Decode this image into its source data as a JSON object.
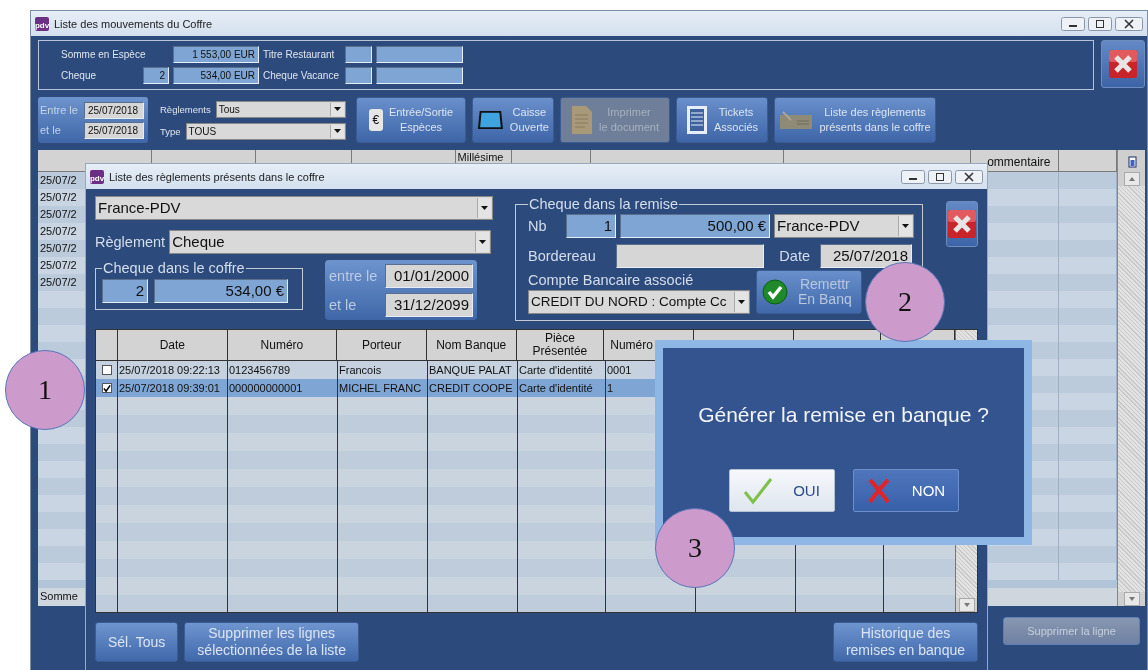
{
  "main_window": {
    "logo": "pdv",
    "title": "Liste des mouvements du Coffre",
    "summary": {
      "cash_label": "Somme en Espèce",
      "cash_total": "1 553,00 EUR",
      "cheque_label": "Cheque",
      "cheque_count": "2",
      "cheque_total": "534,00 EUR",
      "restaurant_label": "Titre Restaurant",
      "vacance_label": "Cheque Vacance"
    },
    "period": {
      "from_label": "Entre le",
      "from": "25/07/2018",
      "to_label": "et le",
      "to": "25/07/2018"
    },
    "filters": [
      {
        "label": "Règlements",
        "value": "Tous"
      },
      {
        "label": "Type",
        "value": "TOUS"
      }
    ],
    "toolbar": [
      {
        "kind": "euro",
        "glyph": "€",
        "label": "Entrée/Sortie\nEspèces",
        "disabled": false
      },
      {
        "kind": "tablet",
        "label": "Caisse\nOuverte",
        "disabled": false
      },
      {
        "kind": "document",
        "label": "Imprimer\nle document",
        "disabled": true
      },
      {
        "kind": "list",
        "label": "Tickets\nAssociés",
        "disabled": false
      },
      {
        "kind": "cheque",
        "label": "Liste des règlements\nprésents dans le coffre",
        "disabled": false
      }
    ],
    "table": {
      "columns": [
        "Millésime",
        "ommentaire"
      ],
      "rows": [
        "25/07/2",
        "25/07/2",
        "25/07/2",
        "25/07/2",
        "25/07/2",
        "25/07/2",
        "25/07/2"
      ],
      "footer_label": "Somme"
    },
    "delete_button": {
      "label": "Supprimer la ligne",
      "disabled": true
    }
  },
  "dialog": {
    "logo": "pdv",
    "title": "Liste des règlements présents dans le coffre",
    "shop": "France-PDV",
    "payment_label": "Règlement",
    "payment": "Cheque",
    "safe_group": {
      "title": "Cheque dans le coffre",
      "count": "2",
      "total": "534,00 €"
    },
    "period": {
      "from_label": "entre le",
      "from": "01/01/2000",
      "to_label": "et le",
      "to": "31/12/2099"
    },
    "deposit_group": {
      "title": "Cheque dans la remise",
      "nb_label": "Nb",
      "count": "1",
      "total": "500,00 €",
      "shop": "France-PDV",
      "slip_label": "Bordereau",
      "date_label": "Date",
      "date": "25/07/2018",
      "account_label": "Compte Bancaire associé",
      "account": "CREDIT DU NORD : Compte Cc"
    },
    "deposit_button": "Remettr\nEn Banq",
    "table": {
      "columns": [
        "Date",
        "Numéro",
        "Porteur",
        "Nom Banque",
        "Pièce\nPrésentée",
        "Numéro"
      ],
      "rows": [
        {
          "checked": false,
          "selected": false,
          "cells": [
            "25/07/2018 09:22:13",
            "0123456789",
            "Francois",
            "BANQUE PALAT",
            "Carte d'identité",
            "0001"
          ]
        },
        {
          "checked": true,
          "selected": true,
          "cells": [
            "25/07/2018 09:39:01",
            "000000000001",
            "MICHEL FRANC",
            "CREDIT COOPE",
            "Carte d'identité",
            "1"
          ]
        }
      ]
    },
    "buttons": [
      "Sél. Tous",
      "Supprimer les lignes\nsélectionnées de la liste",
      "Historique des\nremises en banque"
    ]
  },
  "confirm": {
    "message": "Générer la remise en banque ?",
    "buttons": [
      {
        "kind": "yes",
        "label": "OUI"
      },
      {
        "kind": "no",
        "label": "NON"
      }
    ]
  },
  "annotations": [
    "1",
    "2",
    "3"
  ]
}
